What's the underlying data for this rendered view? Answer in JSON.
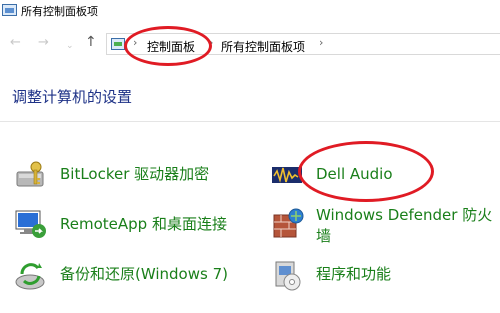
{
  "window": {
    "title": "所有控制面板项",
    "icon": "control-panel-icon"
  },
  "nav": {
    "back_glyph": "←",
    "forward_glyph": "→",
    "recent_glyph": "⌄",
    "up_glyph": "↑",
    "breadcrumb_sep": "›",
    "breadcrumbs": [
      "控制面板",
      "所有控制面板项"
    ]
  },
  "main": {
    "heading": "调整计算机的设置",
    "items": [
      {
        "label": "BitLocker 驱动器加密",
        "icon": "bitlocker-key-icon"
      },
      {
        "label": "Dell Audio",
        "icon": "dell-audio-icon"
      },
      {
        "label": "RemoteApp 和桌面连接",
        "icon": "remoteapp-icon"
      },
      {
        "label": "Windows Defender 防火墙",
        "icon": "firewall-icon"
      },
      {
        "label": "备份和还原(Windows 7)",
        "icon": "backup-restore-icon"
      },
      {
        "label": "程序和功能",
        "icon": "programs-features-icon"
      }
    ]
  },
  "colors": {
    "link_green": "#1a7f1a",
    "heading_blue": "#1e3287",
    "annotation_red": "#e01b24"
  }
}
